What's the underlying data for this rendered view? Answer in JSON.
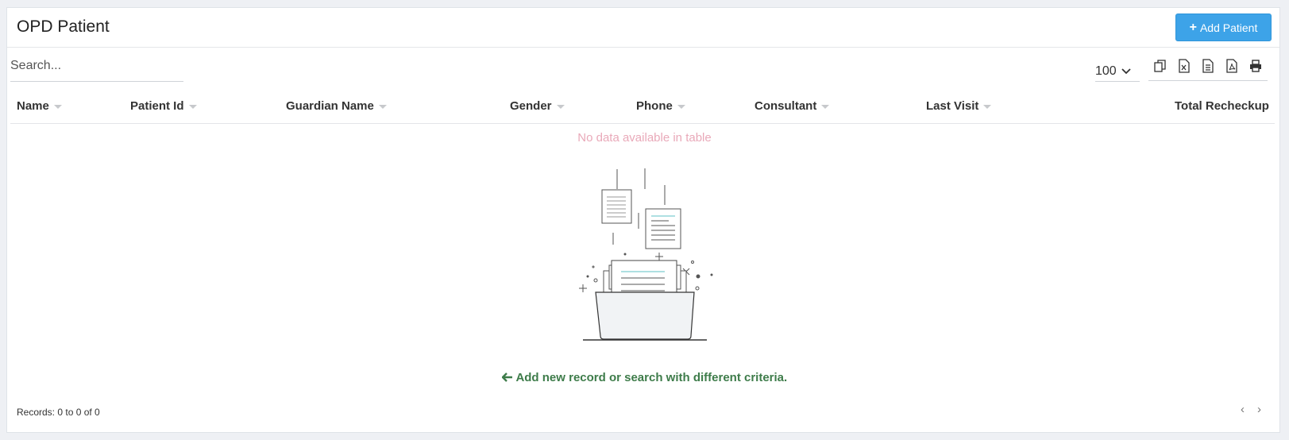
{
  "header": {
    "title": "OPD Patient",
    "add_button_label": "Add Patient"
  },
  "search": {
    "placeholder": "Search..."
  },
  "page_length": {
    "selected": "100"
  },
  "export_icons": [
    "copy-icon",
    "excel-icon",
    "csv-icon",
    "pdf-icon",
    "print-icon"
  ],
  "table": {
    "columns": [
      "Name",
      "Patient Id",
      "Guardian Name",
      "Gender",
      "Phone",
      "Consultant",
      "Last Visit",
      "Total Recheckup"
    ],
    "empty_message": "No data available in table",
    "hint": "Add new record or search with different criteria."
  },
  "footer": {
    "records": "Records: 0 to 0 of 0"
  },
  "colors": {
    "accent": "#3da3e8",
    "empty_message": "#e9a9b9",
    "hint": "#3e7c4a"
  }
}
